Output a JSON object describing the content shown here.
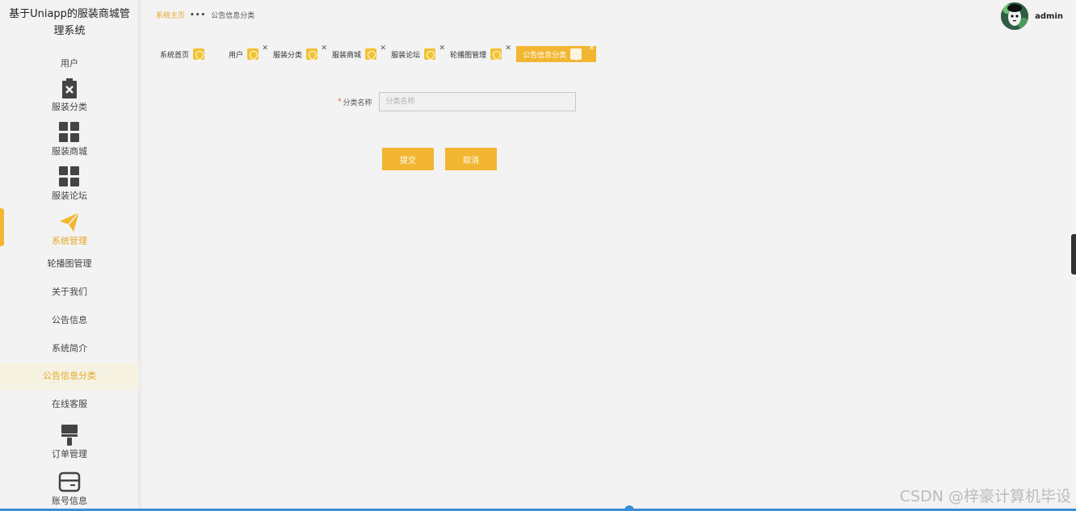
{
  "app": {
    "title": "基于Uniapp的服装商城管理系统"
  },
  "sidebar": {
    "items": [
      {
        "label": "用户",
        "icon": "user-icon"
      },
      {
        "label": "服装分类",
        "icon": "clipboard-x-icon"
      },
      {
        "label": "服装商城",
        "icon": "grid-icon"
      },
      {
        "label": "服装论坛",
        "icon": "grid-icon"
      },
      {
        "label": "系统管理",
        "icon": "paper-plane-icon"
      },
      {
        "label": "订单管理",
        "icon": "brush-icon"
      },
      {
        "label": "账号信息",
        "icon": "card-icon"
      }
    ],
    "subitems": [
      {
        "label": "轮播图管理"
      },
      {
        "label": "关于我们"
      },
      {
        "label": "公告信息"
      },
      {
        "label": "系统简介"
      },
      {
        "label": "公告信息分类"
      },
      {
        "label": "在线客服"
      }
    ]
  },
  "header": {
    "breadcrumb_home": "系统主页",
    "breadcrumb_sep": "•••",
    "breadcrumb_current": "公告信息分类",
    "username": "admin"
  },
  "tabs": [
    {
      "label": "系统首页",
      "closable": false
    },
    {
      "label": "用户",
      "closable": true
    },
    {
      "label": "服装分类",
      "closable": true
    },
    {
      "label": "服装商城",
      "closable": true
    },
    {
      "label": "服装论坛",
      "closable": true
    },
    {
      "label": "轮播图管理",
      "closable": true
    },
    {
      "label": "公告信息分类",
      "closable": true
    }
  ],
  "form": {
    "required_mark": "*",
    "field_label": "分类名称",
    "field_placeholder": "分类名称",
    "submit_label": "提交",
    "cancel_label": "取消"
  },
  "watermark": "CSDN @梓豪计算机毕设",
  "colors": {
    "accent": "#f2b632",
    "accent_text": "#e8a825"
  }
}
